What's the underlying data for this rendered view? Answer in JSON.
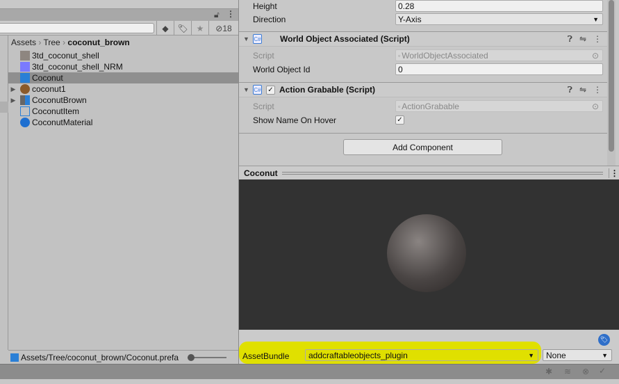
{
  "project": {
    "hidden_count": "18",
    "breadcrumb": [
      "Assets",
      "Tree",
      "coconut_brown"
    ],
    "items": [
      {
        "label": "3td_coconut_shell",
        "icon": "texture-icon",
        "expandable": false,
        "selected": false
      },
      {
        "label": "3td_coconut_shell_NRM",
        "icon": "normal-map-icon",
        "expandable": false,
        "selected": false
      },
      {
        "label": "Coconut",
        "icon": "prefab-icon",
        "expandable": false,
        "selected": true
      },
      {
        "label": "coconut1",
        "icon": "model-icon",
        "expandable": true,
        "selected": false
      },
      {
        "label": "CoconutBrown",
        "icon": "prefab-variant-icon",
        "expandable": true,
        "selected": false
      },
      {
        "label": "CoconutItem",
        "icon": "script-prefab-icon",
        "expandable": false,
        "selected": false
      },
      {
        "label": "CoconutMaterial",
        "icon": "material-icon",
        "expandable": false,
        "selected": false
      }
    ],
    "status_path": "Assets/Tree/coconut_brown/Coconut.prefa"
  },
  "inspector": {
    "height_label": "Height",
    "height_value": "0.28",
    "direction_label": "Direction",
    "direction_value": "Y-Axis",
    "comp1": {
      "title": "World Object Associated (Script)",
      "script_label": "Script",
      "script_value": "WorldObjectAssociated",
      "field_label": "World Object Id",
      "field_value": "0"
    },
    "comp2": {
      "title": "Action Grabable (Script)",
      "script_label": "Script",
      "script_value": "ActionGrabable",
      "field_label": "Show Name On Hover",
      "checked": true
    },
    "add_component": "Add Component",
    "preview_title": "Coconut",
    "assetbundle_label": "AssetBundle",
    "assetbundle_value": "addcraftableobjects_plugin",
    "variant_value": "None",
    "highlight_color": "#e0e000"
  }
}
